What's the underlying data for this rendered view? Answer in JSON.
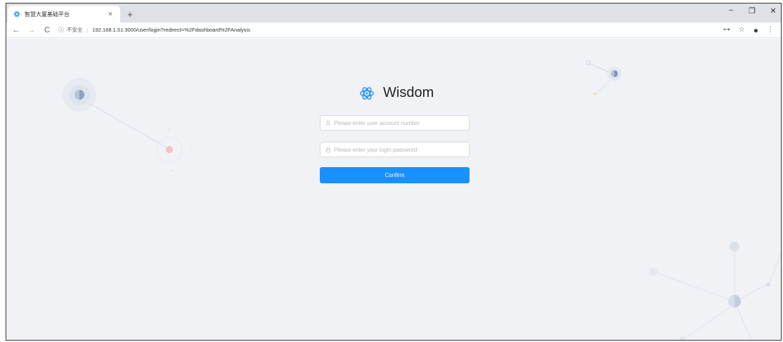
{
  "browser": {
    "tab_title": "智慧大厦基础平台",
    "tab_close": "×",
    "new_tab": "+",
    "controls": {
      "minimize": "−",
      "restore": "❐",
      "close": "✕"
    },
    "nav": {
      "back": "←",
      "forward": "→",
      "reload": "C"
    },
    "address": {
      "info": "ⓘ",
      "security_label": "不安全",
      "separator": "|",
      "url": "192.168.1.51:3000/user/login?redirect=%2Fdashboard%2FAnalysis"
    },
    "tools": {
      "key": "⊶",
      "star": "☆",
      "account": "●",
      "menu": "⋮"
    }
  },
  "login": {
    "brand": "Wisdom",
    "account_placeholder": "Please enter user account number",
    "password_placeholder": "Please enter your login password",
    "confirm_label": "Confirm"
  },
  "colors": {
    "primary": "#1890ff",
    "background": "#f0f2f5",
    "brand_icon": "#1890ff"
  }
}
